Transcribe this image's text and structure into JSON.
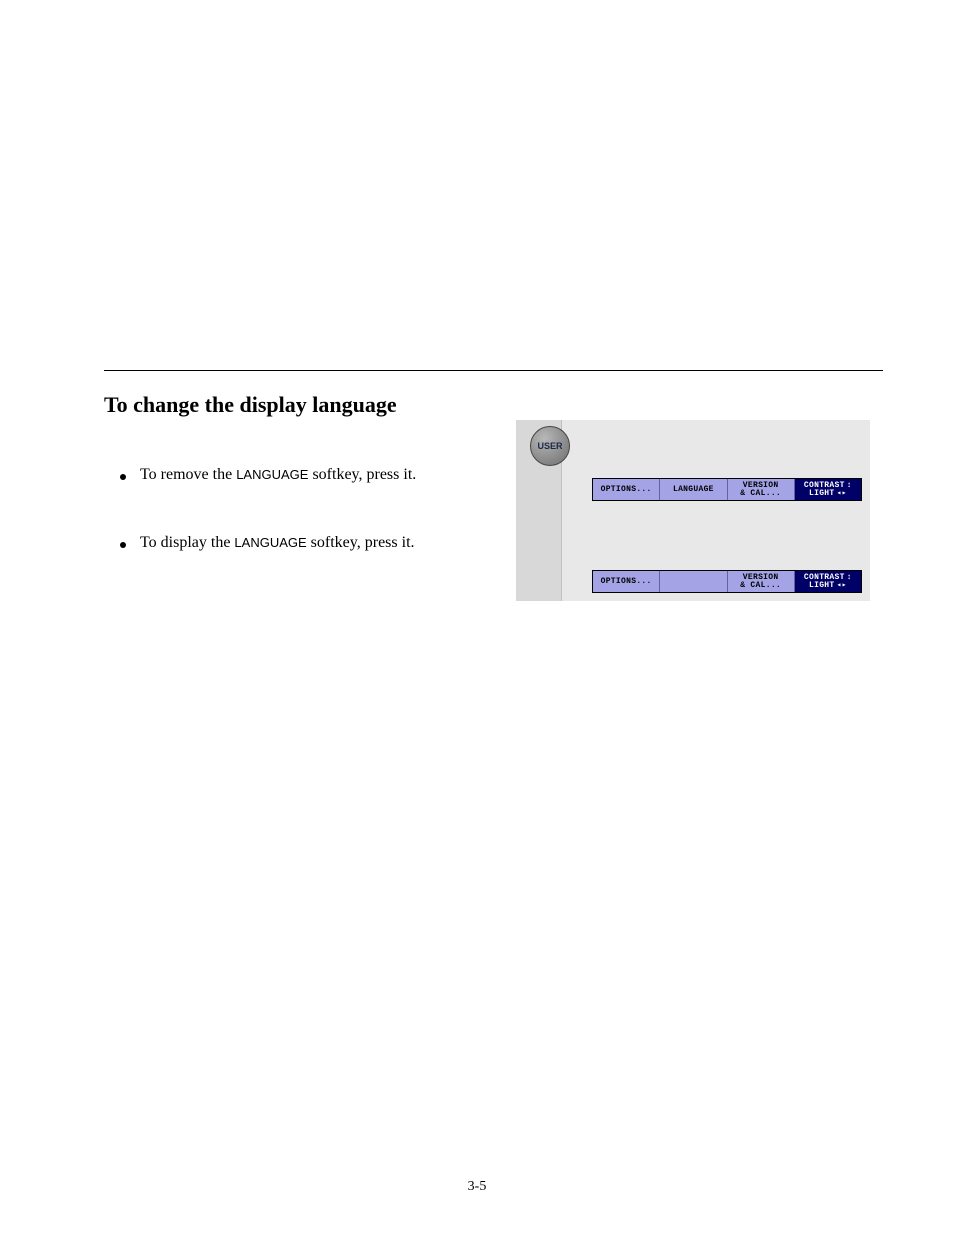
{
  "heading": "To change the display language",
  "user_button_label": "USER",
  "bullets": [
    {
      "text_prefix": "To remove the ",
      "key": "LANGUAGE",
      "text_suffix": " softkey, press it."
    },
    {
      "text_prefix": "To display the ",
      "key": "LANGUAGE",
      "text_suffix": " softkey, press it."
    }
  ],
  "bars": {
    "bar1": {
      "keys": [
        {
          "label": "OPTIONS...",
          "selected": false
        },
        {
          "label": "LANGUAGE",
          "selected": false
        },
        {
          "line1": "VERSION",
          "line2": "& CAL...",
          "selected": false
        },
        {
          "line1": "CONTRAST",
          "line2": "LIGHT",
          "selected": true,
          "arrows": true
        }
      ]
    },
    "bar2": {
      "keys": [
        {
          "label": "OPTIONS...",
          "selected": false
        },
        {
          "label": "",
          "selected": false,
          "empty": true
        },
        {
          "line1": "VERSION",
          "line2": "& CAL...",
          "selected": false
        },
        {
          "line1": "CONTRAST",
          "line2": "LIGHT",
          "selected": true,
          "arrows": true
        }
      ]
    }
  },
  "footer": "3-5"
}
